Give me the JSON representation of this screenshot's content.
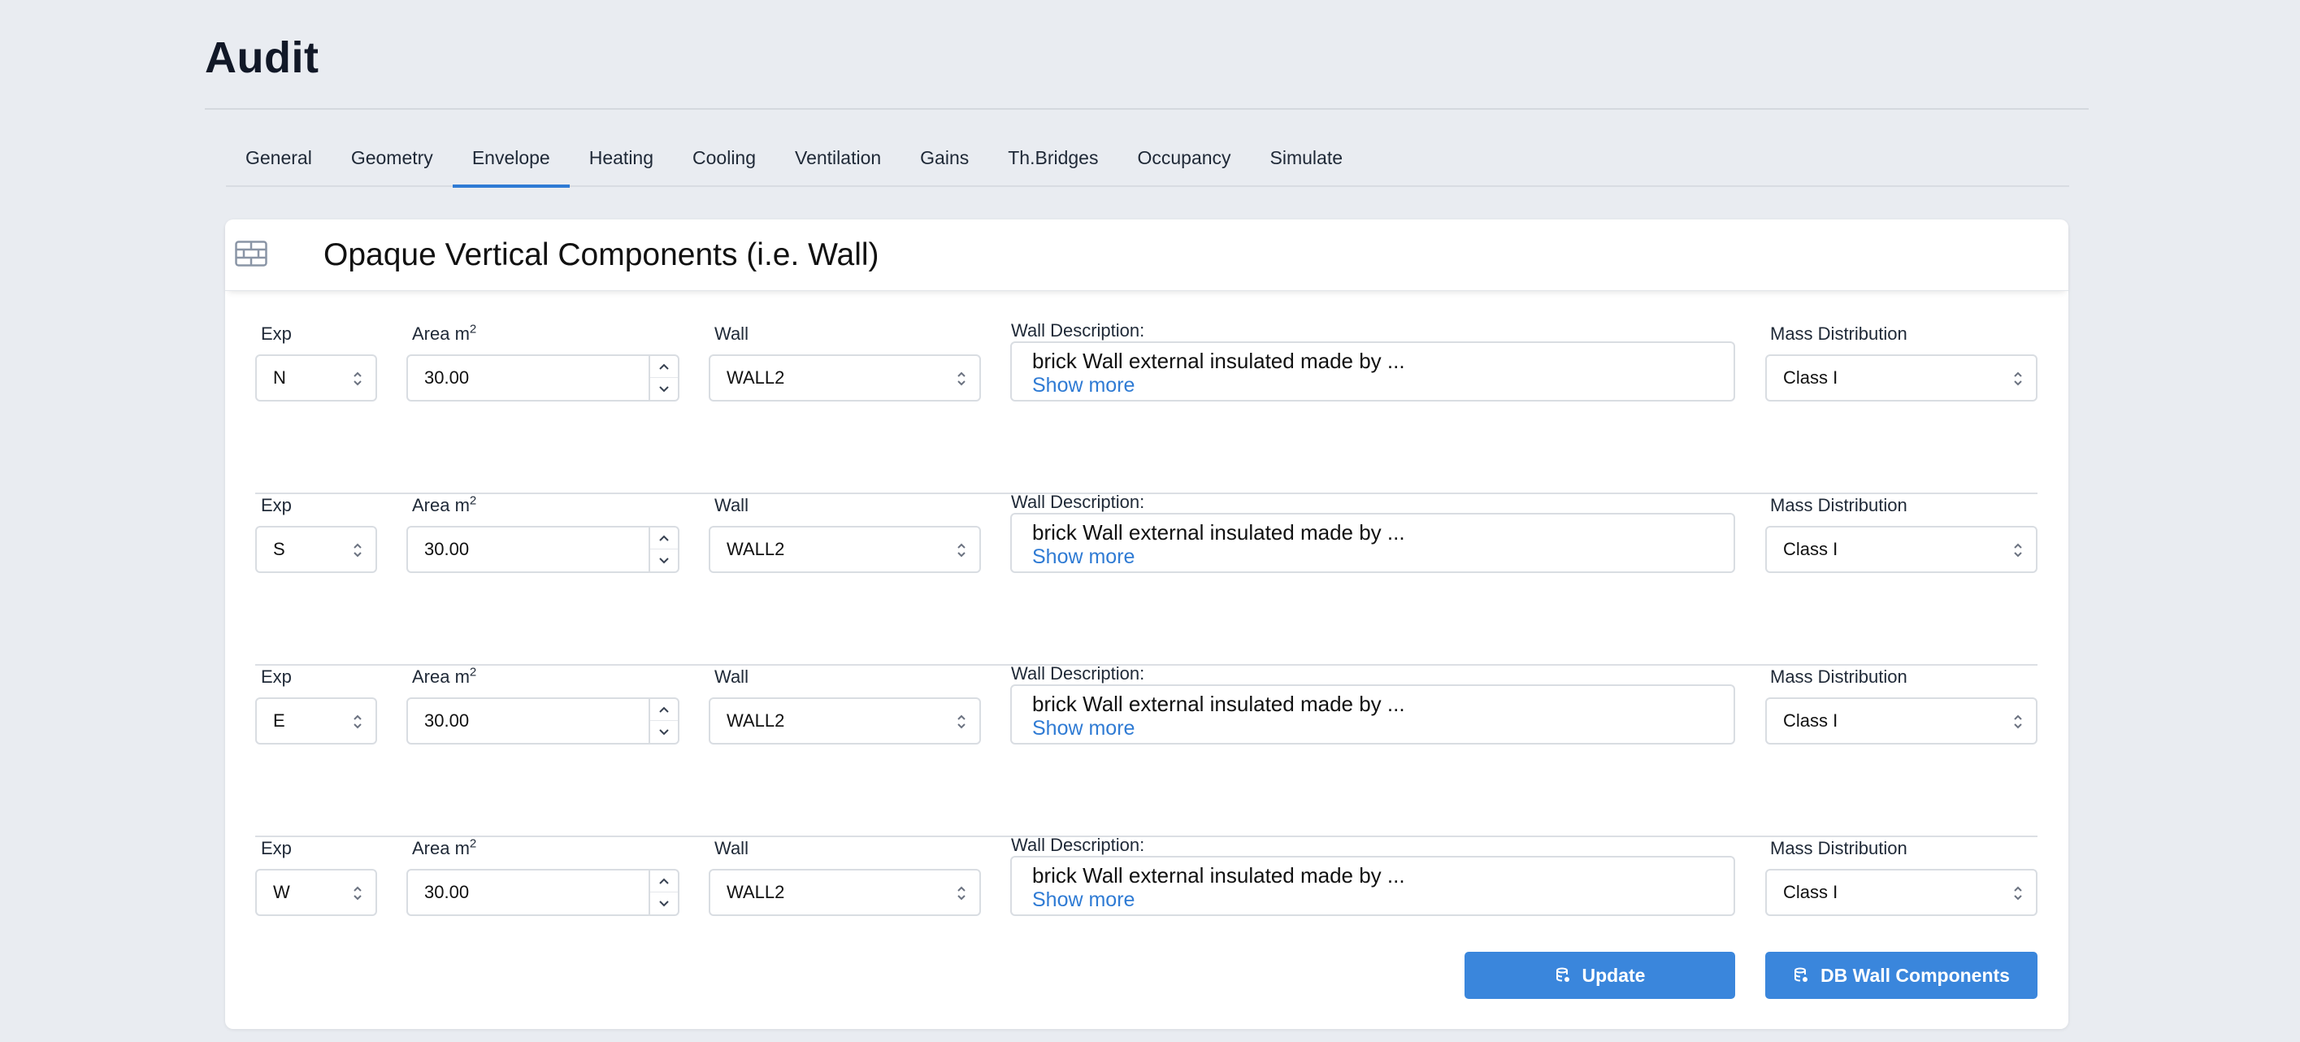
{
  "page": {
    "title": "Audit"
  },
  "tabs": [
    {
      "label": "General",
      "active": false
    },
    {
      "label": "Geometry",
      "active": false
    },
    {
      "label": "Envelope",
      "active": true
    },
    {
      "label": "Heating",
      "active": false
    },
    {
      "label": "Cooling",
      "active": false
    },
    {
      "label": "Ventilation",
      "active": false
    },
    {
      "label": "Gains",
      "active": false
    },
    {
      "label": "Th.Bridges",
      "active": false
    },
    {
      "label": "Occupancy",
      "active": false
    },
    {
      "label": "Simulate",
      "active": false
    }
  ],
  "card": {
    "icon": "brick-wall-icon",
    "title": "Opaque Vertical Components (i.e. Wall)"
  },
  "labels": {
    "exp": "Exp",
    "area": "Area m",
    "area_unit_sup": "2",
    "wall": "Wall",
    "wall_description": "Wall Description:",
    "mass_distribution": "Mass Distribution"
  },
  "rows": [
    {
      "exp": "N",
      "area": "30.00",
      "wall": "WALL2",
      "description": "brick Wall external insulated made by ...",
      "show_more": "Show more",
      "mass_distribution": "Class I"
    },
    {
      "exp": "S",
      "area": "30.00",
      "wall": "WALL2",
      "description": "brick Wall external insulated made by ...",
      "show_more": "Show more",
      "mass_distribution": "Class I"
    },
    {
      "exp": "E",
      "area": "30.00",
      "wall": "WALL2",
      "description": "brick Wall external insulated made by ...",
      "show_more": "Show more",
      "mass_distribution": "Class I"
    },
    {
      "exp": "W",
      "area": "30.00",
      "wall": "WALL2",
      "description": "brick Wall external insulated made by ...",
      "show_more": "Show more",
      "mass_distribution": "Class I"
    }
  ],
  "actions": {
    "update_label": "Update",
    "db_label": "DB Wall Components"
  },
  "colors": {
    "accent": "#3a86dc",
    "link": "#2f7bd4",
    "background": "#e9ecf1"
  }
}
